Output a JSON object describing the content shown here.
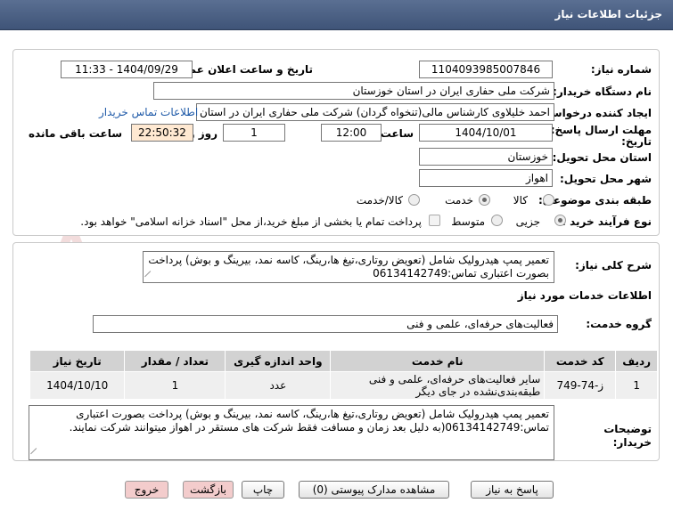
{
  "page": {
    "title": "جزئیات اطلاعات نیاز"
  },
  "fields": {
    "need_number_label": "شماره نیاز:",
    "need_number": "1104093985007846",
    "announce_label": "تاریخ و ساعت اعلان عمومی:",
    "announce_value": "1404/09/29 - 11:33",
    "buyer_org_label": "نام دستگاه خریدار:",
    "buyer_org": "شرکت ملی حفاری ایران در استان خوزستان",
    "creator_label": "ایجاد کننده درخواست:",
    "creator": "احمد خلیلاوی کارشناس مالی(تنخواه گردان) شرکت ملی حفاری ایران در استان",
    "contact_link": "اطلاعات تماس خریدار",
    "deadline_label_1": "مهلت ارسال پاسخ: تا",
    "deadline_label_2": "تاریخ:",
    "deadline_date": "1404/10/01",
    "time_label": "ساعت",
    "deadline_time": "12:00",
    "days_value": "1",
    "days_label": "روز و",
    "remaining_time": "22:50:32",
    "remaining_label": "ساعت باقی مانده",
    "province_label": "استان محل تحویل:",
    "province": "خوزستان",
    "city_label": "شهر محل تحویل:",
    "city": "اهواز",
    "category_label": "طبقه بندی موضوعی:",
    "category_options": [
      "کالا",
      "خدمت",
      "کالا/خدمت"
    ],
    "category_selected": 1,
    "process_label": "نوع فرآیند خرید :",
    "process_options": [
      "جزیی",
      "متوسط"
    ],
    "process_selected": 0,
    "payment_note": "پرداخت تمام یا بخشی از مبلغ خرید،از محل \"اسناد خزانه اسلامی\" خواهد بود."
  },
  "description": {
    "label": "شرح کلی نیاز:",
    "text": "تعمیر پمپ هیدرولیک شامل (تعویض روتاری،تیغ ها،رینگ، کاسه نمد، بیرینگ و بوش) پرداخت بصورت اعتباری تماس:06134142749"
  },
  "services": {
    "section_title": "اطلاعات خدمات مورد نیاز",
    "group_label": "گروه خدمت:",
    "group_value": "فعالیت‌های حرفه‌ای، علمی و فنی",
    "columns": [
      "ردیف",
      "کد خدمت",
      "نام خدمت",
      "واحد اندازه گیری",
      "تعداد / مقدار",
      "تاریخ نیاز"
    ],
    "rows": [
      [
        "1",
        "ز-74-749",
        "سایر فعالیت‌های حرفه‌ای، علمی و فنی طبقه‌بندی‌نشده در جای دیگر",
        "عدد",
        "1",
        "1404/10/10"
      ]
    ]
  },
  "buyer_notes": {
    "label_1": "توضیحات",
    "label_2": "خریدار:",
    "text": "تعمیر پمپ هیدرولیک شامل (تعویض روتاری،تیغ ها،رینگ، کاسه نمد، بیرینگ و بوش) پرداخت بصورت اعتباری تماس:06134142749(به دلیل بعد زمان و مسافت فقط شرکت های مستقر در اهواز میتوانند شرکت نمایند."
  },
  "buttons": {
    "respond": "پاسخ به نیاز",
    "attachments": "مشاهده مدارک پیوستی (0)",
    "print": "چاپ",
    "back": "بازگشت",
    "exit": "خروج"
  },
  "watermark": {
    "text": "AriaTender.net"
  },
  "colors": {
    "header": "#4a5f84",
    "link": "#1f5aa8",
    "shade": "#ffe9d2",
    "button_pink": "#f3cccc"
  }
}
